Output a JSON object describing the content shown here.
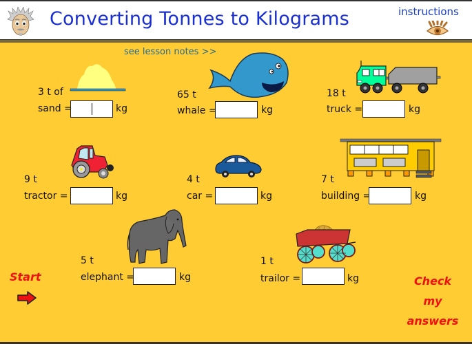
{
  "header": {
    "title": "Converting Tonnes to Kilograms",
    "instructions_label": "instructions",
    "mascot_icon": "einstein-mascot-icon",
    "instructions_icon": "eye-icon"
  },
  "lesson_link": "see lesson notes >>",
  "unit": "kg",
  "problems": [
    {
      "id": "sand",
      "amount": "3 t of",
      "label": "sand =",
      "value": "",
      "picture": "sand-pile-icon",
      "focused": true
    },
    {
      "id": "whale",
      "amount": "65 t",
      "label": "whale =",
      "value": "",
      "picture": "whale-icon"
    },
    {
      "id": "truck",
      "amount": "18 t",
      "label": "truck =",
      "value": "",
      "picture": "truck-icon"
    },
    {
      "id": "tractor",
      "amount": "9 t",
      "label": "tractor =",
      "value": "",
      "picture": "tractor-icon"
    },
    {
      "id": "car",
      "amount": "4 t",
      "label": "car =",
      "value": "",
      "picture": "car-icon"
    },
    {
      "id": "building",
      "amount": "7 t",
      "label": "building =",
      "value": "",
      "picture": "building-icon"
    },
    {
      "id": "elephant",
      "amount": "5 t",
      "label": "elephant =",
      "value": "",
      "picture": "elephant-icon"
    },
    {
      "id": "trailor",
      "amount": "1 t",
      "label": "trailor =",
      "value": "",
      "picture": "hay-trailer-icon"
    }
  ],
  "controls": {
    "start_label": "Start",
    "start_icon": "red-arrow-right-icon",
    "check_label": "Check my answers"
  },
  "colors": {
    "background": "#ffcc33",
    "title": "#1a2fd0",
    "action_text": "#ee1111"
  }
}
